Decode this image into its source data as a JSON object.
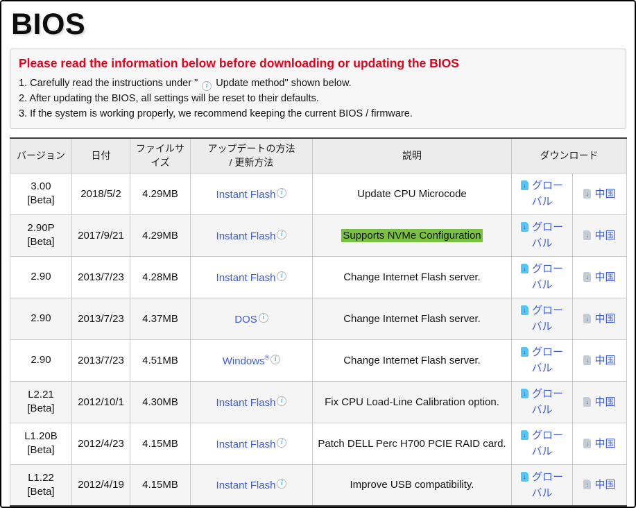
{
  "colors": {
    "notice_red": "#e60019",
    "link_blue": "#3c5be4",
    "highlight_green": "#79c043",
    "download_icon_blue": "#57c4f5",
    "download_icon_gray": "#c3ccd4"
  },
  "icons": {
    "info_glyph": "i"
  },
  "page": {
    "title": "BIOS"
  },
  "notice": {
    "heading": "Please read the information below before downloading or updating the BIOS",
    "item1_prefix": "1. Carefully read the instructions under \" ",
    "item1_suffix": " Update method\" shown below.",
    "item2": "2. After updating the BIOS, all settings will be reset to their defaults.",
    "item3": "3. If the system is working properly, we recommend keeping the current BIOS / firmware."
  },
  "table": {
    "headers": {
      "version": "バージョン",
      "date": "日付",
      "size": "ファイルサイズ",
      "method": "アップデートの方法\n/ 更新方法",
      "description": "説明",
      "download": "ダウンロード"
    },
    "link_global": "グローバル",
    "link_china": "中国",
    "rows": [
      {
        "version": "3.00",
        "tag": "[Beta]",
        "date": "2018/5/2",
        "size": "4.29MB",
        "method": "Instant Flash",
        "method_sup": "",
        "desc": "Update CPU Microcode",
        "desc_class": "plain"
      },
      {
        "version": "2.90P",
        "tag": "[Beta]",
        "date": "2017/9/21",
        "size": "4.29MB",
        "method": "Instant Flash",
        "method_sup": "",
        "desc": "Supports NVMe Configuration",
        "desc_class": "highlight"
      },
      {
        "version": "2.90",
        "tag": "",
        "date": "2013/7/23",
        "size": "4.28MB",
        "method": "Instant Flash",
        "method_sup": "",
        "desc": "Change Internet Flash server.",
        "desc_class": "plain"
      },
      {
        "version": "2.90",
        "tag": "",
        "date": "2013/7/23",
        "size": "4.37MB",
        "method": "DOS",
        "method_sup": "",
        "desc": "Change Internet Flash server.",
        "desc_class": "plain"
      },
      {
        "version": "2.90",
        "tag": "",
        "date": "2013/7/23",
        "size": "4.51MB",
        "method": "Windows",
        "method_sup": "®",
        "desc": "Change Internet Flash server.",
        "desc_class": "plain"
      },
      {
        "version": "L2.21",
        "tag": "[Beta]",
        "date": "2012/10/1",
        "size": "4.30MB",
        "method": "Instant Flash",
        "method_sup": "",
        "desc": "Fix CPU Load-Line Calibration option.",
        "desc_class": "plain"
      },
      {
        "version": "L1.20B",
        "tag": "[Beta]",
        "date": "2012/4/23",
        "size": "4.15MB",
        "method": "Instant Flash",
        "method_sup": "",
        "desc": "Patch DELL Perc H700 PCIE RAID card.",
        "desc_class": "plain"
      },
      {
        "version": "L1.22",
        "tag": "[Beta]",
        "date": "2012/4/19",
        "size": "4.15MB",
        "method": "Instant Flash",
        "method_sup": "",
        "desc": "Improve USB compatibility.",
        "desc_class": "plain"
      }
    ]
  }
}
